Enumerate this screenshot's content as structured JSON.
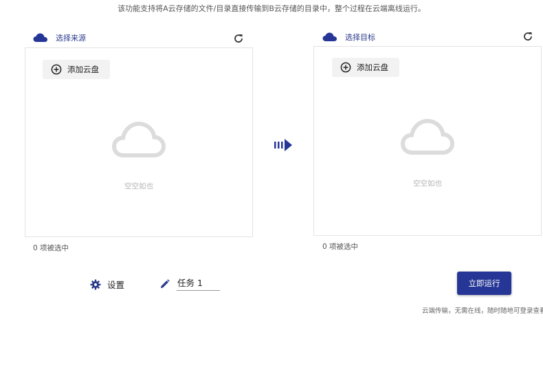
{
  "top_note": "该功能支持将A云存储的文件/目录直接传输到B云存储的目录中，整个过程在云端离线运行。",
  "source": {
    "label": "选择来源",
    "add_button": "添加云盘",
    "empty_text": "空空如也",
    "selected_count": "0 项被选中"
  },
  "target": {
    "label": "选择目标",
    "add_button": "添加云盘",
    "empty_text": "空空如也",
    "selected_count": "0 项被选中"
  },
  "settings_label": "设置",
  "task_name": "任务 1",
  "run_button": "立即运行",
  "bottom_note": "云端传输，无需在线，随时随地可登录查看",
  "colors": {
    "accent": "#263696",
    "label": "#2b3a8c"
  }
}
